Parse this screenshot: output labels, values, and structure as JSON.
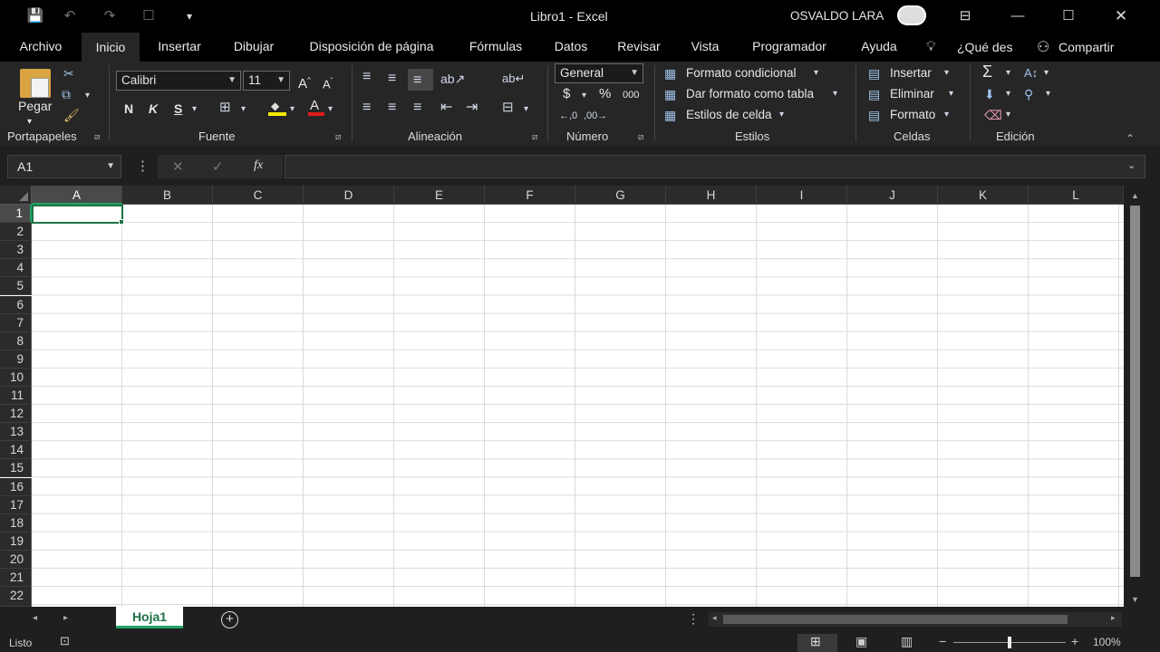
{
  "window": {
    "title": "Libro1  -  Excel",
    "user": "OSVALDO LARA",
    "glyph_save": "💾",
    "glyph_undo": "↶",
    "glyph_redo": "↷",
    "glyph_touch": "☐",
    "glyph_more": "▾",
    "glyph_minimize": "—",
    "glyph_maximize": "☐",
    "glyph_close": "✕",
    "glyph_display_options": "⊟"
  },
  "tabs": [
    "Archivo",
    "Inicio",
    "Insertar",
    "Dibujar",
    "Disposición de página",
    "Fórmulas",
    "Datos",
    "Revisar",
    "Vista",
    "Programador",
    "Ayuda"
  ],
  "tell_me": "¿Qué des",
  "share": "Compartir",
  "ribbon": {
    "clipboard": {
      "paste": "Pegar",
      "label": "Portapapeles"
    },
    "font": {
      "name": "Calibri",
      "size": "11",
      "bold": "N",
      "italic": "K",
      "underline": "S",
      "label": "Fuente"
    },
    "alignment": {
      "label": "Alineación"
    },
    "number": {
      "format": "General",
      "currency": "$",
      "percent": "%",
      "thousands": "000",
      "label": "Número"
    },
    "styles": {
      "conditional": "Formato condicional",
      "as_table": "Dar formato como tabla",
      "cell_styles": "Estilos de celda",
      "label": "Estilos"
    },
    "cells": {
      "insert": "Insertar",
      "delete": "Eliminar",
      "format": "Formato",
      "label": "Celdas"
    },
    "editing": {
      "label": "Edición"
    }
  },
  "formula_bar": {
    "name_box": "A1",
    "cancel": "✕",
    "enter": "✓",
    "fx": "fx",
    "value": ""
  },
  "grid": {
    "columns": [
      "A",
      "B",
      "C",
      "D",
      "E",
      "F",
      "G",
      "H",
      "I",
      "J",
      "K",
      "L"
    ],
    "rows": [
      "1",
      "2",
      "3",
      "4",
      "5",
      "6",
      "7",
      "8",
      "9",
      "10",
      "11",
      "12",
      "13",
      "14",
      "15",
      "16",
      "17",
      "18",
      "19",
      "20",
      "21",
      "22"
    ],
    "selected_cell": "A1"
  },
  "sheets": {
    "tabs": [
      "Hoja1"
    ],
    "active": "Hoja1"
  },
  "status": {
    "mode": "Listo",
    "zoom": "100%"
  },
  "colors": {
    "accent": "#21a366",
    "selection": "#1e7145",
    "background": "#1f1f1f"
  }
}
